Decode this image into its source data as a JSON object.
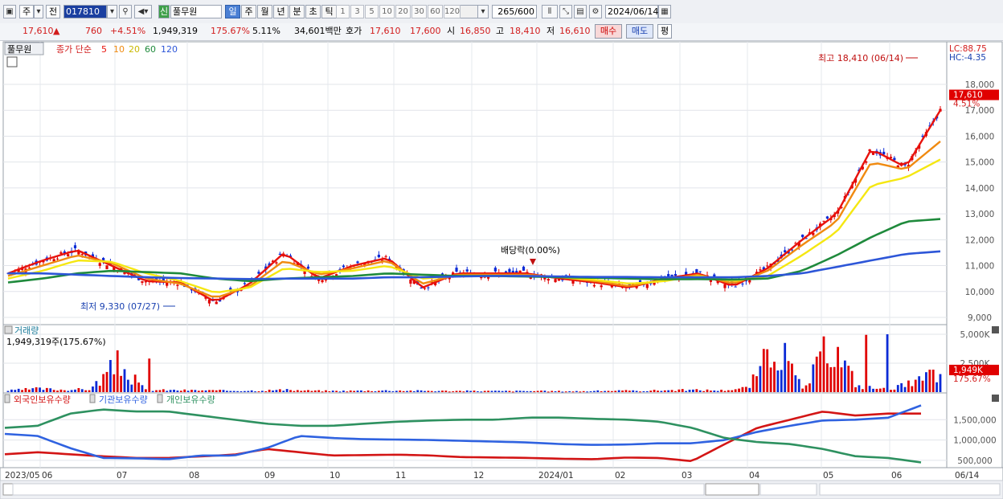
{
  "toolbar": {
    "type_label": "주",
    "prev_label": "전",
    "code": "017810",
    "new_badge": "신",
    "stock_name": "풀무원",
    "periods": [
      "일",
      "주",
      "월",
      "년",
      "분",
      "초",
      "틱"
    ],
    "selected_period": "일",
    "nums": [
      "1",
      "3",
      "5",
      "10",
      "20",
      "30",
      "60",
      "120"
    ],
    "count_value": "265",
    "count_total": "/600",
    "date_value": "2024/06/14"
  },
  "quote": {
    "price": "17,610",
    "arrow": "▲",
    "change": "760",
    "change_pct": "+4.51%",
    "volume": "1,949,319",
    "volume_ratio": "175.67%",
    "turnover": "5.11%",
    "amount": "34,601백만",
    "bid_label": "호가",
    "ask_price": "17,610",
    "bid_price": "17,600",
    "open_label": "시",
    "open": "16,850",
    "high_label": "고",
    "high": "18,410",
    "low_label": "저",
    "low": "16,610",
    "buy_label": "매수",
    "sell_label": "매도",
    "eval_label": "평"
  },
  "colors": {
    "up": "#e00000",
    "down": "#0b2ad6",
    "ma5": "#e8120c",
    "ma10": "#f08a10",
    "ma20": "#f5e712",
    "ma60": "#1f8a3c",
    "ma120": "#2d56d8",
    "foreign": "#d31515",
    "institution": "#2f62e0",
    "individual": "#2e9160"
  },
  "price_panel": {
    "stock_label": "풀무원",
    "legend": {
      "prefix": "종가 단순",
      "ma5": "5",
      "ma10": "10",
      "ma20": "20",
      "ma60": "60",
      "ma120": "120"
    },
    "lc": "LC:88.75",
    "hc": "HC:-4.35",
    "current_tag": "17,610",
    "current_pct": "4.51%",
    "high_note": "최고 18,410 (06/14)",
    "low_note": "최저 9,330 (07/27)",
    "dividend_note": "배당락(0.00%)"
  },
  "volume_panel": {
    "title": "거래량",
    "info": "1,949,319주(175.67%)",
    "current_tag": "1,949K",
    "current_pct": "175.67%"
  },
  "holdings_panel": {
    "legend": [
      "외국인보유수량",
      "기관보유수량",
      "개인보유수량"
    ]
  },
  "chart_data": [
    {
      "type": "candlestick",
      "title": "풀무원",
      "y_tick_labels": [
        "18,000",
        "17,000",
        "16,000",
        "15,000",
        "14,000",
        "13,000",
        "12,000",
        "11,000",
        "10,000",
        "9,000"
      ],
      "ylim": [
        8800,
        18900
      ],
      "x_tick_labels": [
        "2023/05",
        "06",
        "07",
        "08",
        "09",
        "10",
        "11",
        "12",
        "2024/01",
        "02",
        "03",
        "04",
        "05",
        "06"
      ],
      "series": [
        {
          "name": "5",
          "values": [
            10700,
            11200,
            11600,
            11000,
            10400,
            10350,
            9600,
            10300,
            11500,
            10500,
            11000,
            11300,
            10150,
            10700,
            10700,
            10700,
            10500,
            10350,
            10150,
            10500,
            10700,
            10200,
            10900,
            12000,
            13000,
            15500,
            14800,
            17000
          ]
        },
        {
          "name": "10",
          "values": [
            10600,
            11000,
            11400,
            11100,
            10500,
            10300,
            9750,
            10200,
            11200,
            10650,
            10900,
            11200,
            10300,
            10650,
            10650,
            10650,
            10550,
            10400,
            10200,
            10450,
            10650,
            10300,
            10800,
            11800,
            12700,
            15000,
            14700,
            15800
          ]
        },
        {
          "name": "20",
          "values": [
            10500,
            10800,
            11200,
            11150,
            10700,
            10400,
            9950,
            10150,
            10900,
            10750,
            10800,
            11000,
            10500,
            10600,
            10600,
            10600,
            10550,
            10450,
            10300,
            10400,
            10600,
            10400,
            10600,
            11400,
            12300,
            14100,
            14400,
            15100
          ]
        },
        {
          "name": "60",
          "values": [
            10350,
            10500,
            10700,
            10800,
            10750,
            10700,
            10500,
            10400,
            10500,
            10550,
            10600,
            10700,
            10650,
            10600,
            10600,
            10580,
            10550,
            10530,
            10500,
            10470,
            10480,
            10460,
            10500,
            10800,
            11400,
            12100,
            12700,
            12800
          ]
        },
        {
          "name": "120",
          "values": [
            10700,
            10700,
            10650,
            10600,
            10550,
            10520,
            10500,
            10480,
            10500,
            10500,
            10500,
            10550,
            10550,
            10580,
            10600,
            10600,
            10580,
            10560,
            10560,
            10550,
            10550,
            10550,
            10600,
            10700,
            10950,
            11200,
            11450,
            11550
          ]
        }
      ],
      "markers": {
        "high": 18410,
        "low": 9330,
        "current": 17610
      }
    },
    {
      "type": "bar",
      "title": "거래량",
      "y_tick_labels": [
        "5,000K",
        "2,500K"
      ],
      "ylim": [
        0,
        5000
      ],
      "values_k": [
        150,
        350,
        250,
        300,
        2900,
        220,
        200,
        180,
        150,
        160,
        220,
        150,
        120,
        150,
        170,
        140,
        120,
        120,
        110,
        110,
        100,
        90,
        150,
        130,
        200,
        220,
        180,
        450,
        5000,
        200,
        5000,
        600,
        300,
        900,
        1949
      ]
    },
    {
      "type": "line",
      "y_tick_labels": [
        "1,500,000",
        "1,000,000",
        "500,000"
      ],
      "ylim": [
        400000,
        1900000
      ],
      "series": [
        {
          "name": "외국인보유수량",
          "values": [
            650000,
            700000,
            650000,
            600000,
            560000,
            560000,
            600000,
            640000,
            780000,
            700000,
            620000,
            630000,
            640000,
            620000,
            580000,
            570000,
            560000,
            540000,
            530000,
            570000,
            560000,
            480000,
            900000,
            1300000,
            1500000,
            1700000,
            1600000,
            1650000,
            1650000
          ]
        },
        {
          "name": "기관보유수량",
          "values": [
            1150000,
            1100000,
            800000,
            560000,
            550000,
            530000,
            620000,
            620000,
            800000,
            1100000,
            1050000,
            1020000,
            1010000,
            1000000,
            980000,
            960000,
            940000,
            900000,
            880000,
            890000,
            920000,
            920000,
            1000000,
            1200000,
            1350000,
            1480000,
            1500000,
            1550000,
            1850000
          ]
        },
        {
          "name": "개인보유수량",
          "values": [
            1300000,
            1350000,
            1650000,
            1750000,
            1700000,
            1700000,
            1600000,
            1500000,
            1400000,
            1350000,
            1350000,
            1400000,
            1450000,
            1480000,
            1500000,
            1500000,
            1550000,
            1550000,
            1520000,
            1500000,
            1450000,
            1300000,
            1050000,
            950000,
            900000,
            780000,
            600000,
            560000,
            450000
          ]
        }
      ]
    }
  ]
}
